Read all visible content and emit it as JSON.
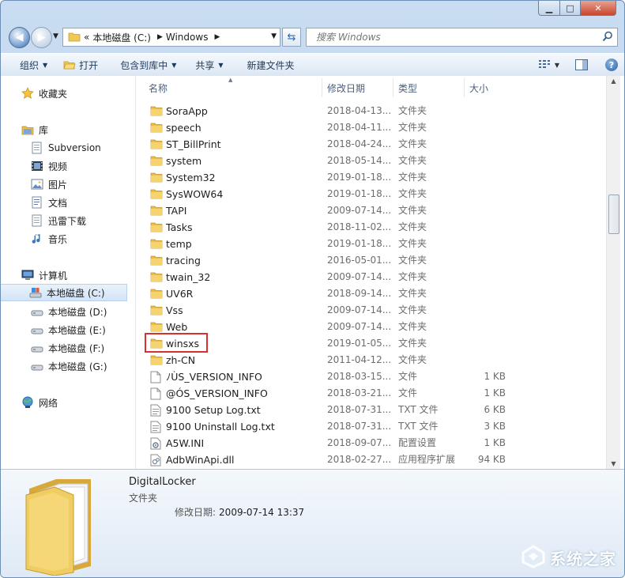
{
  "titlebar": {
    "minimize": "▁",
    "maximize": "□",
    "close": "✕"
  },
  "nav": {
    "breadcrumb_prefix": "«",
    "crumbs": [
      "本地磁盘 (C:)",
      "Windows"
    ],
    "search_placeholder": "搜索 Windows"
  },
  "toolbar": {
    "organize": "组织",
    "open": "打开",
    "include_library": "包含到库中",
    "share": "共享",
    "new_folder": "新建文件夹"
  },
  "sidebar": {
    "favorites": "收藏夹",
    "libraries": "库",
    "library_items": [
      "Subversion",
      "视频",
      "图片",
      "文档",
      "迅雷下载",
      "音乐"
    ],
    "computer": "计算机",
    "drives": [
      "本地磁盘 (C:)",
      "本地磁盘 (D:)",
      "本地磁盘 (E:)",
      "本地磁盘 (F:)",
      "本地磁盘 (G:)"
    ],
    "network": "网络"
  },
  "columns": {
    "name": "名称",
    "modified": "修改日期",
    "type": "类型",
    "size": "大小"
  },
  "files": [
    {
      "name": "SoraApp",
      "date": "2018-04-13...",
      "type": "文件夹",
      "size": "",
      "icon": "folder"
    },
    {
      "name": "speech",
      "date": "2018-04-11...",
      "type": "文件夹",
      "size": "",
      "icon": "folder"
    },
    {
      "name": "ST_BillPrint",
      "date": "2018-04-24...",
      "type": "文件夹",
      "size": "",
      "icon": "folder"
    },
    {
      "name": "system",
      "date": "2018-05-14...",
      "type": "文件夹",
      "size": "",
      "icon": "folder"
    },
    {
      "name": "System32",
      "date": "2019-01-18...",
      "type": "文件夹",
      "size": "",
      "icon": "folder"
    },
    {
      "name": "SysWOW64",
      "date": "2019-01-18...",
      "type": "文件夹",
      "size": "",
      "icon": "folder"
    },
    {
      "name": "TAPI",
      "date": "2009-07-14...",
      "type": "文件夹",
      "size": "",
      "icon": "folder"
    },
    {
      "name": "Tasks",
      "date": "2018-11-02...",
      "type": "文件夹",
      "size": "",
      "icon": "folder"
    },
    {
      "name": "temp",
      "date": "2019-01-18...",
      "type": "文件夹",
      "size": "",
      "icon": "folder"
    },
    {
      "name": "tracing",
      "date": "2016-05-01...",
      "type": "文件夹",
      "size": "",
      "icon": "folder"
    },
    {
      "name": "twain_32",
      "date": "2009-07-14...",
      "type": "文件夹",
      "size": "",
      "icon": "folder"
    },
    {
      "name": "UV6R",
      "date": "2018-09-14...",
      "type": "文件夹",
      "size": "",
      "icon": "folder"
    },
    {
      "name": "Vss",
      "date": "2009-07-14...",
      "type": "文件夹",
      "size": "",
      "icon": "folder"
    },
    {
      "name": "Web",
      "date": "2009-07-14...",
      "type": "文件夹",
      "size": "",
      "icon": "folder"
    },
    {
      "name": "winsxs",
      "date": "2019-01-05...",
      "type": "文件夹",
      "size": "",
      "icon": "folder"
    },
    {
      "name": "zh-CN",
      "date": "2011-04-12...",
      "type": "文件夹",
      "size": "",
      "icon": "folder"
    },
    {
      "name": "ﾉÙS_VERSION_INFO",
      "date": "2018-03-15...",
      "type": "文件",
      "size": "1 KB",
      "icon": "file"
    },
    {
      "name": "@ÓS_VERSION_INFO",
      "date": "2018-03-21...",
      "type": "文件",
      "size": "1 KB",
      "icon": "file"
    },
    {
      "name": "9100 Setup Log.txt",
      "date": "2018-07-31...",
      "type": "TXT 文件",
      "size": "6 KB",
      "icon": "text"
    },
    {
      "name": "9100 Uninstall Log.txt",
      "date": "2018-07-31...",
      "type": "TXT 文件",
      "size": "3 KB",
      "icon": "text"
    },
    {
      "name": "A5W.INI",
      "date": "2018-09-07...",
      "type": "配置设置",
      "size": "1 KB",
      "icon": "ini"
    },
    {
      "name": "AdbWinApi.dll",
      "date": "2018-02-27...",
      "type": "应用程序扩展",
      "size": "94 KB",
      "icon": "dll"
    }
  ],
  "details": {
    "name": "DigitalLocker",
    "type": "文件夹",
    "modified_label": "修改日期:",
    "modified_value": "2009-07-14 13:37"
  },
  "watermark": {
    "text": "系统之家"
  }
}
